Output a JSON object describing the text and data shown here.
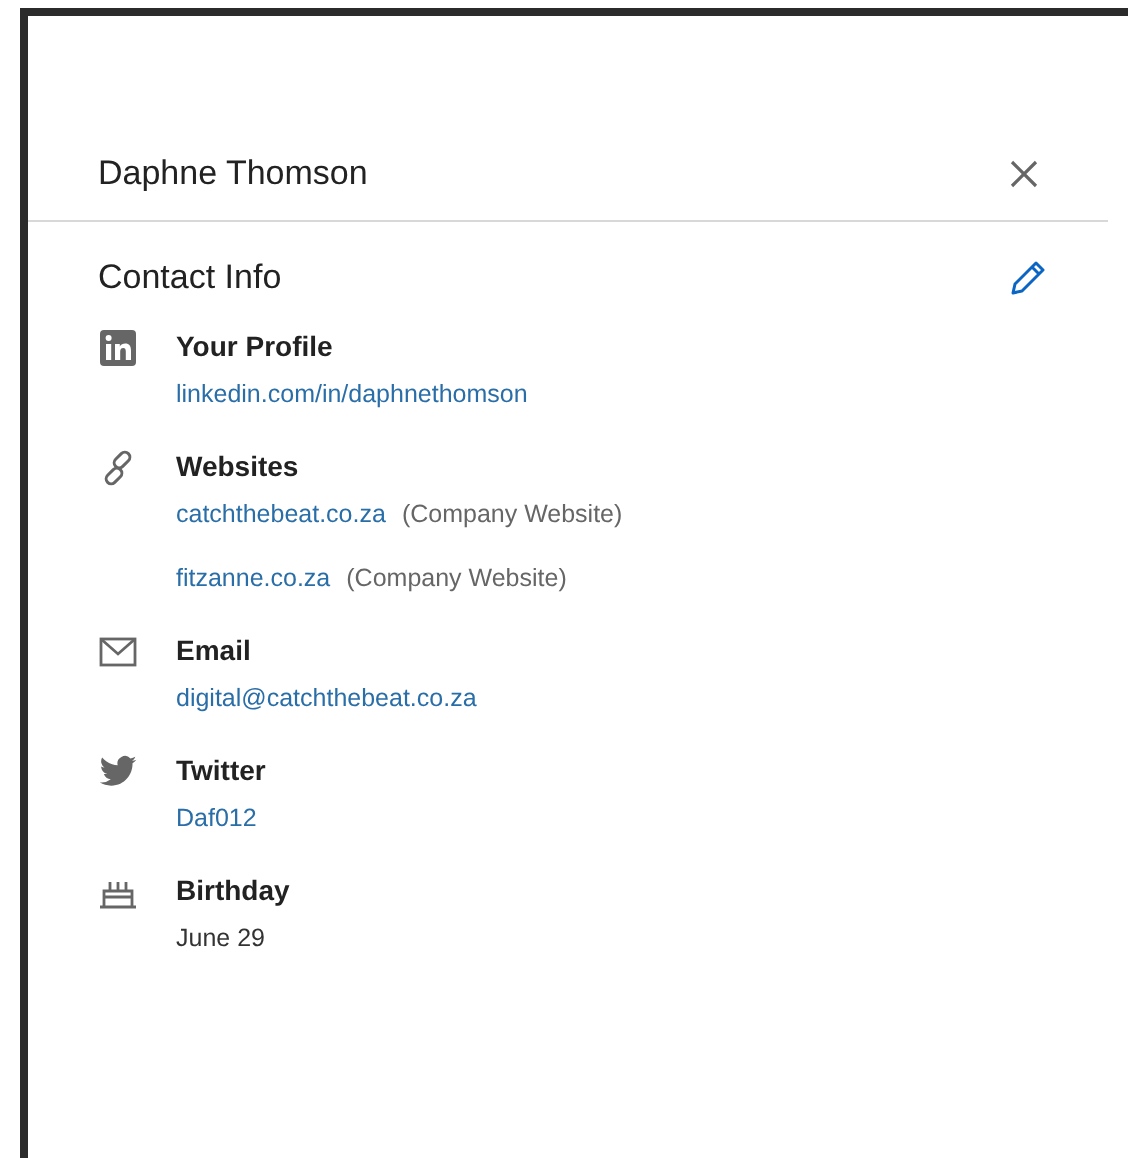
{
  "header": {
    "title": "Daphne Thomson"
  },
  "section": {
    "title": "Contact Info"
  },
  "items": [
    {
      "kind": "profile",
      "label": "Your Profile",
      "values": [
        {
          "text": "linkedin.com/in/daphnethomson",
          "link": true
        }
      ]
    },
    {
      "kind": "websites",
      "label": "Websites",
      "values": [
        {
          "text": "catchthebeat.co.za",
          "note": "(Company Website)",
          "link": true
        },
        {
          "text": "fitzanne.co.za",
          "note": "(Company Website)",
          "link": true
        }
      ]
    },
    {
      "kind": "email",
      "label": "Email",
      "values": [
        {
          "text": "digital@catchthebeat.co.za",
          "link": true
        }
      ]
    },
    {
      "kind": "twitter",
      "label": "Twitter",
      "values": [
        {
          "text": "Daf012",
          "link": true
        }
      ]
    },
    {
      "kind": "birthday",
      "label": "Birthday",
      "values": [
        {
          "text": "June 29",
          "link": false
        }
      ]
    }
  ]
}
